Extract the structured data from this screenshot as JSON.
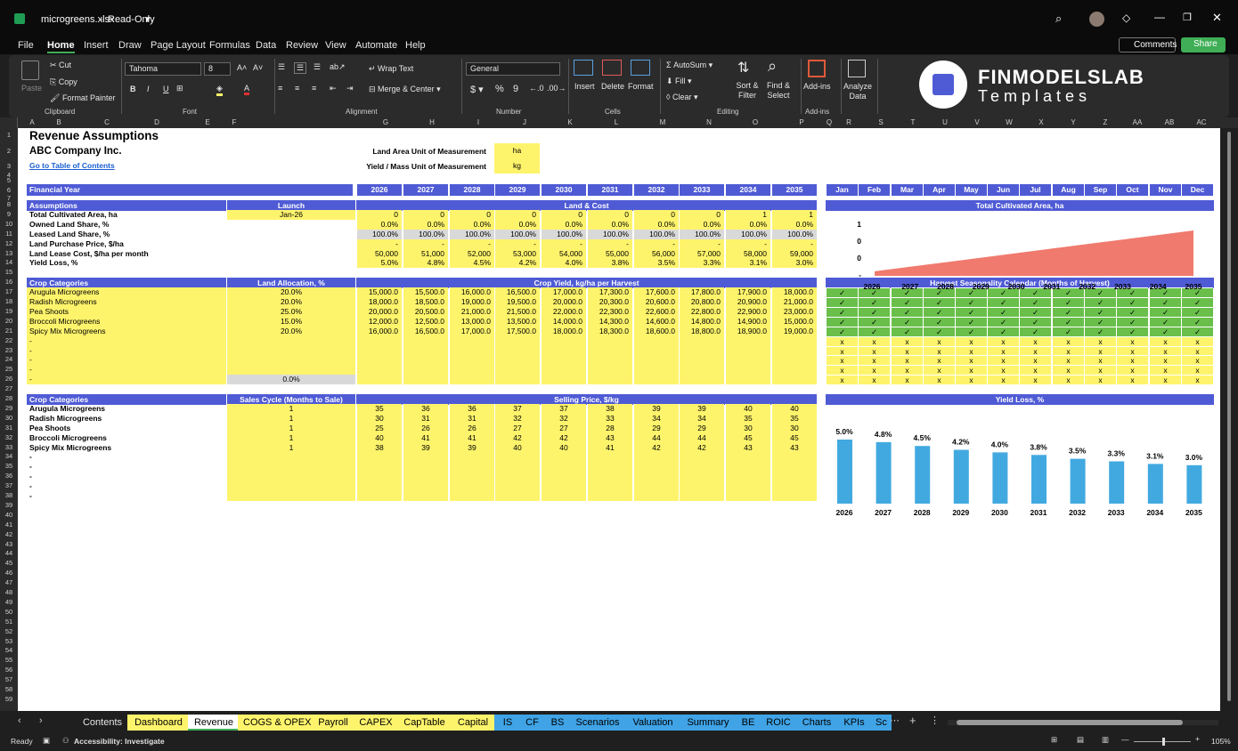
{
  "window": {
    "file_name": "microgreens.xlsx",
    "mode": "Read-Only",
    "mode_arrow": "▾"
  },
  "menu": {
    "items": [
      "File",
      "Home",
      "Insert",
      "Draw",
      "Page Layout",
      "Formulas",
      "Data",
      "Review",
      "View",
      "Automate",
      "Help"
    ],
    "active": "Home",
    "comments": "Comments",
    "share": "Share"
  },
  "ribbon": {
    "clipboard": {
      "paste": "Paste",
      "cut": "Cut",
      "copy": "Copy",
      "format_painter": "Format Painter",
      "group": "Clipboard"
    },
    "font": {
      "name": "Tahoma",
      "size": "8",
      "group": "Font"
    },
    "alignment": {
      "wrap": "Wrap Text",
      "merge": "Merge & Center",
      "group": "Alignment"
    },
    "number": {
      "format": "General",
      "group": "Number"
    },
    "cells": {
      "insert": "Insert",
      "delete": "Delete",
      "format": "Format",
      "group": "Cells"
    },
    "editing": {
      "autosum": "AutoSum",
      "fill": "Fill",
      "clear": "Clear",
      "sort": "Sort & Filter",
      "find": "Find & Select",
      "group": "Editing"
    },
    "addins": {
      "label": "Add-ins",
      "group": "Add-ins"
    },
    "analyze": {
      "label": "Analyze Data"
    },
    "logo": {
      "name": "FINMODELSLAB",
      "sub": "Templates"
    }
  },
  "columns": [
    "A",
    "B",
    "C",
    "D",
    "E",
    "F",
    "G",
    "H",
    "I",
    "J",
    "K",
    "L",
    "M",
    "N",
    "O",
    "P",
    "Q",
    "R",
    "S",
    "T",
    "U",
    "V",
    "W",
    "X",
    "Y",
    "Z",
    "AA",
    "AB",
    "AC"
  ],
  "sheet": {
    "title": "Revenue Assumptions",
    "company": "ABC Company Inc.",
    "toc_link": "Go to Table of Contents",
    "land_unit_label": "Land Area Unit of Measurement",
    "land_unit": "ha",
    "yield_unit_label": "Yield / Mass Unit of Measurement",
    "yield_unit": "kg",
    "fy_label": "Financial Year",
    "years": [
      "2026",
      "2027",
      "2028",
      "2029",
      "2030",
      "2031",
      "2032",
      "2033",
      "2034",
      "2035"
    ],
    "months": [
      "Jan",
      "Feb",
      "Mar",
      "Apr",
      "May",
      "Jun",
      "Jul",
      "Aug",
      "Sep",
      "Oct",
      "Nov",
      "Dec"
    ],
    "assumptions_label": "Assumptions",
    "launch_label": "Launch",
    "land_cost_label": "Land & Cost",
    "launch_value": "Jan-26",
    "land_rows": [
      {
        "label": "Total Cultivated Area, ha",
        "values": [
          "0",
          "0",
          "0",
          "0",
          "0",
          "0",
          "0",
          "0",
          "1",
          "1"
        ],
        "style": "yl"
      },
      {
        "label": "Owned Land Share, %",
        "values": [
          "0.0%",
          "0.0%",
          "0.0%",
          "0.0%",
          "0.0%",
          "0.0%",
          "0.0%",
          "0.0%",
          "0.0%",
          "0.0%"
        ],
        "style": "yl"
      },
      {
        "label": "Leased Land Share, %",
        "values": [
          "100.0%",
          "100.0%",
          "100.0%",
          "100.0%",
          "100.0%",
          "100.0%",
          "100.0%",
          "100.0%",
          "100.0%",
          "100.0%"
        ],
        "style": "gy"
      },
      {
        "label": "Land Purchase Price, $/ha",
        "values": [
          "-",
          "-",
          "-",
          "-",
          "-",
          "-",
          "-",
          "-",
          "-",
          "-"
        ],
        "style": "yl"
      },
      {
        "label": "Land Lease Cost, $/ha per month",
        "values": [
          "50,000",
          "51,000",
          "52,000",
          "53,000",
          "54,000",
          "55,000",
          "56,000",
          "57,000",
          "58,000",
          "59,000"
        ],
        "style": "yl"
      },
      {
        "label": "Yield Loss, %",
        "values": [
          "5.0%",
          "4.8%",
          "4.5%",
          "4.2%",
          "4.0%",
          "3.8%",
          "3.5%",
          "3.3%",
          "3.1%",
          "3.0%"
        ],
        "style": "yl"
      }
    ],
    "crop_cat_label": "Crop Categories",
    "land_alloc_label": "Land Allocation, %",
    "crop_yield_label": "Crop Yield, kg/ha per Harvest",
    "seasonality_label": "Harvest Seasonality Calendar (Months of Harvest)",
    "crop_rows": [
      {
        "name": "Arugula Microgreens",
        "alloc": "20.0%",
        "values": [
          "15,000.0",
          "15,500.0",
          "16,000.0",
          "16,500.0",
          "17,000.0",
          "17,300.0",
          "17,600.0",
          "17,800.0",
          "17,900.0",
          "18,000.0"
        ]
      },
      {
        "name": "Radish Microgreens",
        "alloc": "20.0%",
        "values": [
          "18,000.0",
          "18,500.0",
          "19,000.0",
          "19,500.0",
          "20,000.0",
          "20,300.0",
          "20,600.0",
          "20,800.0",
          "20,900.0",
          "21,000.0"
        ]
      },
      {
        "name": "Pea Shoots",
        "alloc": "25.0%",
        "values": [
          "20,000.0",
          "20,500.0",
          "21,000.0",
          "21,500.0",
          "22,000.0",
          "22,300.0",
          "22,600.0",
          "22,800.0",
          "22,900.0",
          "23,000.0"
        ]
      },
      {
        "name": "Broccoli Microgreens",
        "alloc": "15.0%",
        "values": [
          "12,000.0",
          "12,500.0",
          "13,000.0",
          "13,500.0",
          "14,000.0",
          "14,300.0",
          "14,600.0",
          "14,800.0",
          "14,900.0",
          "15,000.0"
        ]
      },
      {
        "name": "Spicy Mix Microgreens",
        "alloc": "20.0%",
        "values": [
          "16,000.0",
          "16,500.0",
          "17,000.0",
          "17,500.0",
          "18,000.0",
          "18,300.0",
          "18,600.0",
          "18,800.0",
          "18,900.0",
          "19,000.0"
        ]
      }
    ],
    "blank_rows": [
      "-",
      "-",
      "-",
      "-",
      "-"
    ],
    "alloc_total": "0.0%",
    "check": "✓",
    "cross": "x",
    "sales_cycle_label": "Sales Cycle (Months to Sale)",
    "selling_price_label": "Selling Price, $/kg",
    "price_rows": [
      {
        "name": "Arugula Microgreens",
        "cycle": "1",
        "values": [
          "35",
          "36",
          "36",
          "37",
          "37",
          "38",
          "39",
          "39",
          "40",
          "40"
        ]
      },
      {
        "name": "Radish Microgreens",
        "cycle": "1",
        "values": [
          "30",
          "31",
          "31",
          "32",
          "32",
          "33",
          "34",
          "34",
          "35",
          "35"
        ]
      },
      {
        "name": "Pea Shoots",
        "cycle": "1",
        "values": [
          "25",
          "26",
          "26",
          "27",
          "27",
          "28",
          "29",
          "29",
          "30",
          "30"
        ]
      },
      {
        "name": "Broccoli Microgreens",
        "cycle": "1",
        "values": [
          "40",
          "41",
          "41",
          "42",
          "42",
          "43",
          "44",
          "44",
          "45",
          "45"
        ]
      },
      {
        "name": "Spicy Mix Microgreens",
        "cycle": "1",
        "values": [
          "38",
          "39",
          "39",
          "40",
          "40",
          "41",
          "42",
          "42",
          "43",
          "43"
        ]
      }
    ]
  },
  "chart_data": [
    {
      "type": "area",
      "title": "Total Cultivated Area, ha",
      "x": [
        "2026",
        "2027",
        "2028",
        "2029",
        "2030",
        "2031",
        "2032",
        "2033",
        "2034",
        "2035"
      ],
      "y_tick_labels": [
        "1",
        "0",
        "0",
        "-"
      ],
      "values": [
        0.1,
        0.2,
        0.3,
        0.4,
        0.5,
        0.6,
        0.7,
        0.8,
        0.9,
        1.0
      ],
      "color": "#f07a6e"
    },
    {
      "type": "bar",
      "title": "Yield Loss, %",
      "categories": [
        "2026",
        "2027",
        "2028",
        "2029",
        "2030",
        "2031",
        "2032",
        "2033",
        "2034",
        "2035"
      ],
      "values": [
        5.0,
        4.8,
        4.5,
        4.2,
        4.0,
        3.8,
        3.5,
        3.3,
        3.1,
        3.0
      ],
      "labels": [
        "5.0%",
        "4.8%",
        "4.5%",
        "4.2%",
        "4.0%",
        "3.8%",
        "3.5%",
        "3.3%",
        "3.1%",
        "3.0%"
      ],
      "color": "#42a9e0"
    }
  ],
  "tabs": [
    {
      "label": "Contents",
      "style": "plain"
    },
    {
      "label": "Dashboard",
      "style": "y"
    },
    {
      "label": "Revenue",
      "style": "active"
    },
    {
      "label": "COGS & OPEX",
      "style": "y"
    },
    {
      "label": "Payroll",
      "style": "y"
    },
    {
      "label": "CAPEX",
      "style": "y"
    },
    {
      "label": "CapTable",
      "style": "y"
    },
    {
      "label": "Capital",
      "style": "y"
    },
    {
      "label": "IS",
      "style": "bl"
    },
    {
      "label": "CF",
      "style": "bl"
    },
    {
      "label": "BS",
      "style": "bl"
    },
    {
      "label": "Scenarios",
      "style": "bl"
    },
    {
      "label": "Valuation",
      "style": "bl"
    },
    {
      "label": "Summary",
      "style": "bl"
    },
    {
      "label": "BE",
      "style": "bl"
    },
    {
      "label": "ROIC",
      "style": "bl"
    },
    {
      "label": "Charts",
      "style": "bl"
    },
    {
      "label": "KPIs",
      "style": "bl"
    },
    {
      "label": "Sc",
      "style": "bl"
    }
  ],
  "status": {
    "ready": "Ready",
    "accessibility": "Accessibility: Investigate",
    "zoom": "105%"
  },
  "colors": {
    "header_blue": "#4f5bd5",
    "yellow": "#fef46c",
    "green": "#6abf4b",
    "accent": "#3fae56"
  }
}
